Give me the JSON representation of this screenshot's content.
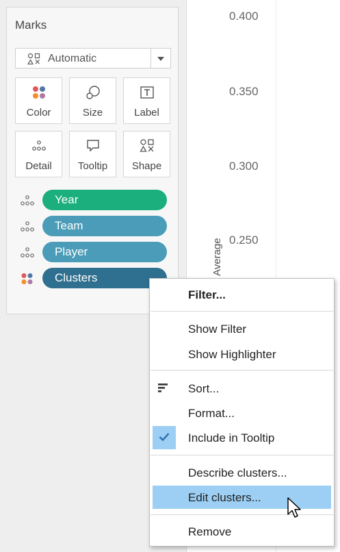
{
  "marks": {
    "title": "Marks",
    "mark_type": "Automatic",
    "buttons": [
      {
        "label": "Color",
        "icon": "color-icon"
      },
      {
        "label": "Size",
        "icon": "size-icon"
      },
      {
        "label": "Label",
        "icon": "label-icon"
      },
      {
        "label": "Detail",
        "icon": "detail-icon"
      },
      {
        "label": "Tooltip",
        "icon": "tooltip-icon"
      },
      {
        "label": "Shape",
        "icon": "shape-icon"
      }
    ],
    "pills": [
      {
        "label": "Year",
        "color": "#1aaf7c",
        "icon": "detail-icon"
      },
      {
        "label": "Team",
        "color": "#4a9cb8",
        "icon": "detail-icon"
      },
      {
        "label": "Player",
        "color": "#4a9cb8",
        "icon": "detail-icon"
      },
      {
        "label": "Clusters",
        "color": "#2f6f8f",
        "icon": "color-icon"
      }
    ]
  },
  "chart": {
    "y_axis_label": "Average",
    "ticks": [
      "0.400",
      "0.350",
      "0.300",
      "0.250"
    ]
  },
  "context_menu": {
    "items": [
      {
        "label": "Filter...",
        "bold": true
      },
      {
        "label": "Show Filter"
      },
      {
        "label": "Show Highlighter"
      },
      {
        "label": "Sort...",
        "icon": "sort-icon"
      },
      {
        "label": "Format..."
      },
      {
        "label": "Include in Tooltip",
        "checked": true,
        "icon": "check-icon"
      },
      {
        "label": "Describe clusters..."
      },
      {
        "label": "Edit clusters...",
        "highlighted": true
      },
      {
        "label": "Remove"
      }
    ]
  },
  "colors": {
    "highlight": "#9ccff3",
    "pill_green": "#1aaf7c",
    "pill_teal": "#4a9cb8",
    "pill_dark": "#2f6f8f"
  }
}
